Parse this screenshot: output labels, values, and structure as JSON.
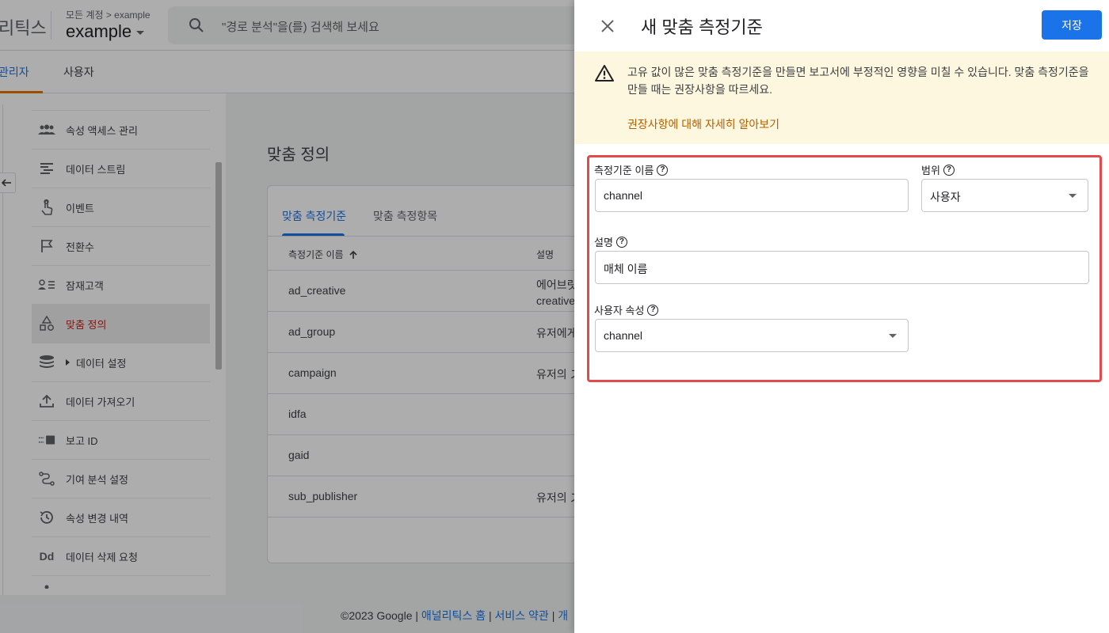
{
  "header": {
    "app_name_fragment": "리틱스",
    "account_breadcrumb": "모든 계정 > example",
    "account_name": "example",
    "search_placeholder": "\"경로 분석\"을(를) 검색해 보세요"
  },
  "subnav": {
    "tabs": [
      {
        "label": "관리자",
        "active": true
      },
      {
        "label": "사용자",
        "active": false
      }
    ]
  },
  "sidebar": {
    "items": [
      {
        "label": "속성 액세스 관리",
        "icon": "people-icon"
      },
      {
        "label": "데이터 스트림",
        "icon": "data-stream-icon"
      },
      {
        "label": "이벤트",
        "icon": "touch-icon"
      },
      {
        "label": "전환수",
        "icon": "flag-icon"
      },
      {
        "label": "잠재고객",
        "icon": "audience-icon"
      },
      {
        "label": "맞춤 정의",
        "icon": "shapes-icon",
        "active": true
      },
      {
        "label": "데이터 설정",
        "icon": "database-icon",
        "expandable": true
      },
      {
        "label": "데이터 가져오기",
        "icon": "upload-icon"
      },
      {
        "label": "보고 ID",
        "icon": "reporting-id-icon"
      },
      {
        "label": "기여 분석 설정",
        "icon": "attribution-icon"
      },
      {
        "label": "속성 변경 내역",
        "icon": "history-icon"
      },
      {
        "label": "데이터 삭제 요청",
        "icon": "data-deletion-icon"
      }
    ]
  },
  "main": {
    "title": "맞춤 정의",
    "tabs": [
      {
        "label": "맞춤 측정기준",
        "active": true
      },
      {
        "label": "맞춤 측정항목",
        "active": false
      }
    ],
    "columns": [
      "측정기준 이름",
      "설명"
    ],
    "rows": [
      {
        "name": "ad_creative",
        "desc": "에어브릿\ncreative"
      },
      {
        "name": "ad_group",
        "desc": "유저에게"
      },
      {
        "name": "campaign",
        "desc": "유저의 ス"
      },
      {
        "name": "idfa",
        "desc": ""
      },
      {
        "name": "gaid",
        "desc": ""
      },
      {
        "name": "sub_publisher",
        "desc": "유저의 ス"
      }
    ]
  },
  "footer": {
    "copyright": "©2023 Google |",
    "link1": "애널리틱스 홈",
    "sep": "|",
    "link2": "서비스 약관",
    "sep2": "|",
    "link3": "개"
  },
  "panel": {
    "title": "새 맞춤 측정기준",
    "save_label": "저장",
    "warning_text": "고유 값이 많은 맞춤 측정기준을 만들면 보고서에 부정적인 영향을 미칠 수 있습니다. 맞춤 측정기준을 만들 때는 권장사항을 따르세요.",
    "warning_link": "권장사항에 대해 자세히 알아보기",
    "form": {
      "name_label": "측정기준 이름",
      "name_value": "channel",
      "scope_label": "범위",
      "scope_value": "사용자",
      "desc_label": "설명",
      "desc_value": "매체 이름",
      "user_prop_label": "사용자 속성",
      "user_prop_value": "channel",
      "help_glyph": "?"
    }
  },
  "colors": {
    "accent": "#1a73e8",
    "warning_bg": "#fef7e0",
    "warning_link": "#b06000",
    "highlight_border": "#e34a4a",
    "active_nav_text": "#c5221f"
  }
}
